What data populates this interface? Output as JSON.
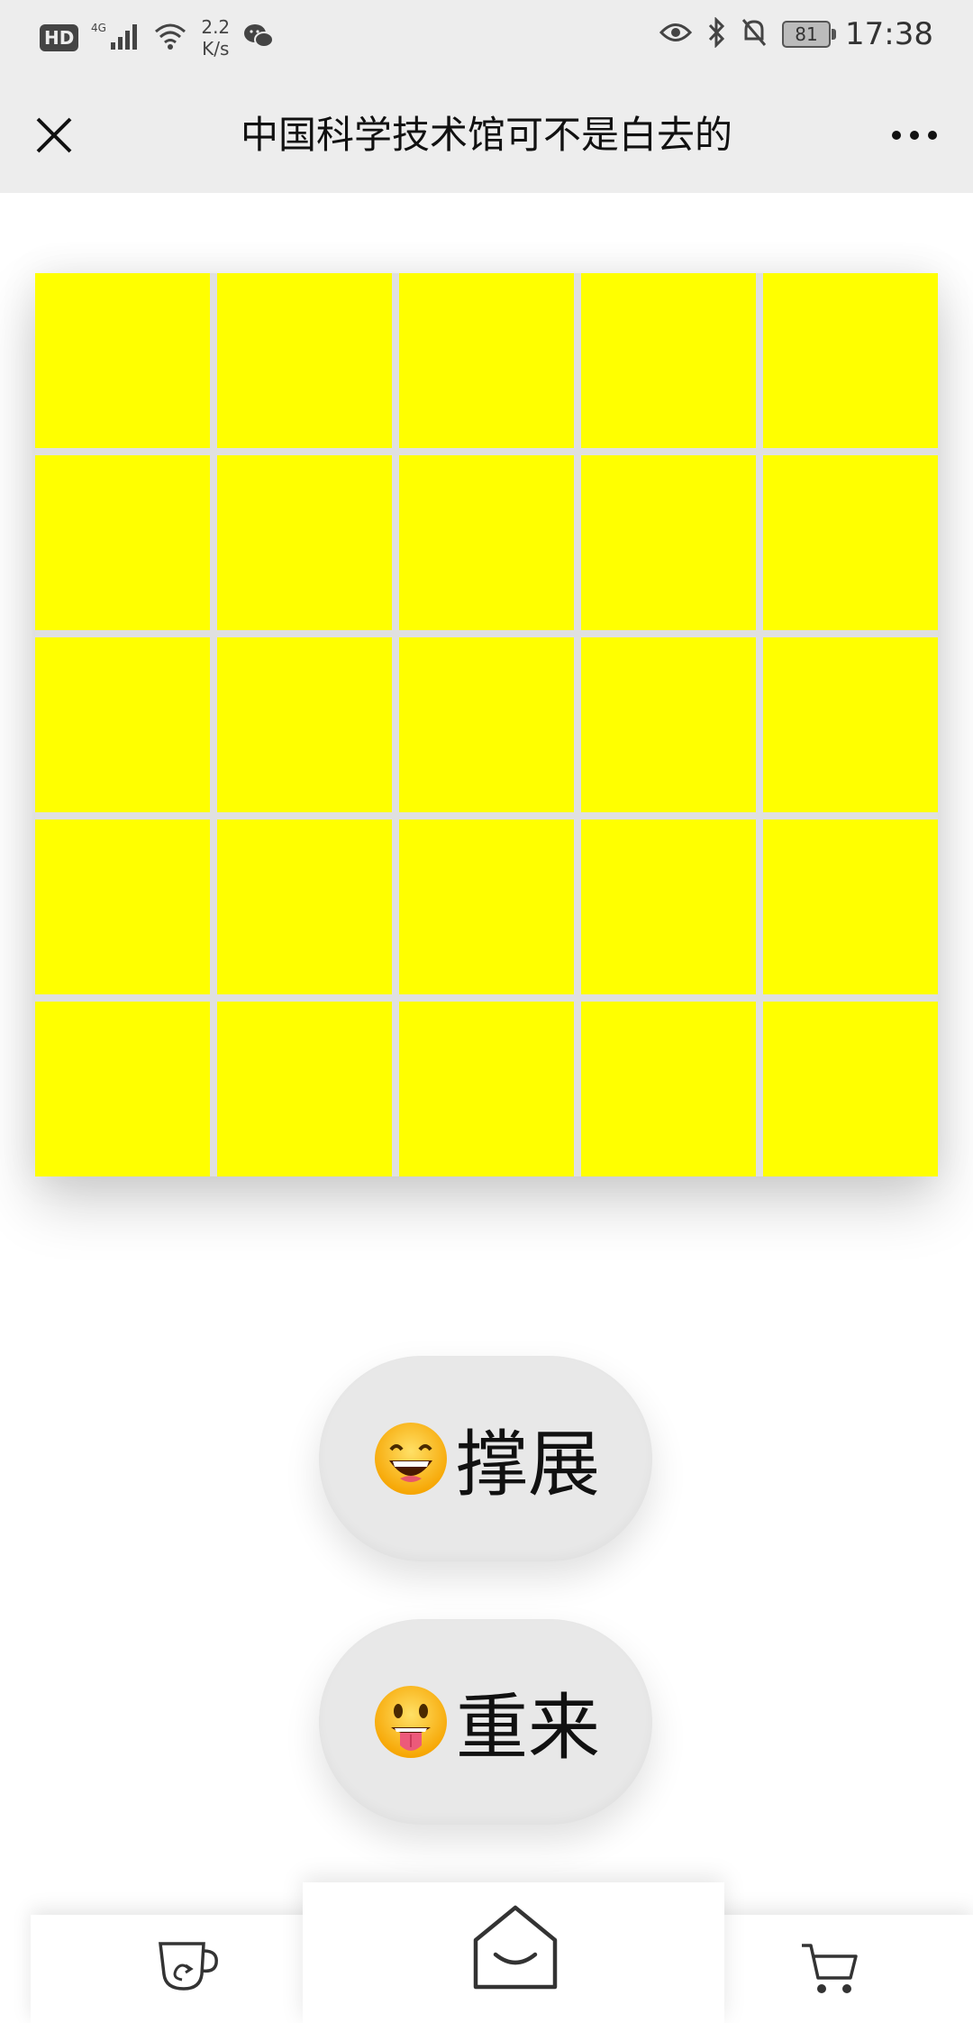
{
  "status_bar": {
    "network_badge": "HD",
    "network_type": "4G",
    "speed_value": "2.2",
    "speed_unit": "K/s",
    "battery": "81",
    "time": "17:38"
  },
  "header": {
    "title": "中国科学技术馆可不是白去的"
  },
  "board": {
    "rows": 5,
    "columns": 5,
    "cell_color": "#ffff00"
  },
  "actions": {
    "expand_label": "撑展",
    "restart_label": "重来"
  },
  "bottom_nav": {
    "items": [
      "cup-icon",
      "home-icon",
      "cart-icon"
    ]
  }
}
